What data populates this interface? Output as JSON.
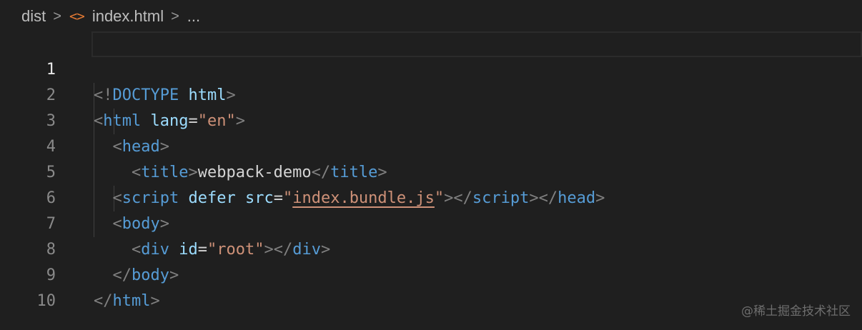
{
  "breadcrumb": {
    "folder": "dist",
    "file": "index.html",
    "more": "...",
    "separator": ">",
    "file_icon_glyph": "<>"
  },
  "editor": {
    "line_numbers": [
      "1",
      "2",
      "3",
      "4",
      "5",
      "6",
      "7",
      "8",
      "9",
      "10"
    ],
    "current_line": 1
  },
  "code": {
    "l1": {
      "open": "<!",
      "doctype": "DOCTYPE",
      "sp": " ",
      "html": "html",
      "close": ">"
    },
    "l2": {
      "open": "<",
      "tag": "html",
      "sp": " ",
      "attr": "lang",
      "eq": "=",
      "val": "\"en\"",
      "close": ">"
    },
    "l3": {
      "open": "<",
      "tag": "head",
      "close": ">"
    },
    "l4": {
      "open": "<",
      "tag": "title",
      "close": ">",
      "text": "webpack-demo",
      "open2": "</",
      "tag2": "title",
      "close2": ">"
    },
    "l5": {
      "open": "<",
      "tag": "script",
      "sp": " ",
      "attr1": "defer",
      "sp2": " ",
      "attr2": "src",
      "eq": "=",
      "q1": "\"",
      "src": "index.bundle.js",
      "q2": "\"",
      "close": ">",
      "open2": "</",
      "tag2": "script",
      "close2": ">",
      "open3": "</",
      "tag3": "head",
      "close3": ">"
    },
    "l6": {
      "open": "<",
      "tag": "body",
      "close": ">"
    },
    "l7": {
      "open": "<",
      "tag": "div",
      "sp": " ",
      "attr": "id",
      "eq": "=",
      "val": "\"root\"",
      "close": ">",
      "open2": "</",
      "tag2": "div",
      "close2": ">"
    },
    "l8": {
      "open": "</",
      "tag": "body",
      "close": ">"
    },
    "l9": {
      "open": "</",
      "tag": "html",
      "close": ">"
    }
  },
  "watermark": "@稀土掘金技术社区",
  "colors": {
    "background": "#1f1f1f",
    "tag": "#569cd6",
    "attribute": "#9cdcfe",
    "string": "#ce9178",
    "punctuation": "#808080",
    "text": "#d4d4d4",
    "file_icon": "#e37933"
  }
}
